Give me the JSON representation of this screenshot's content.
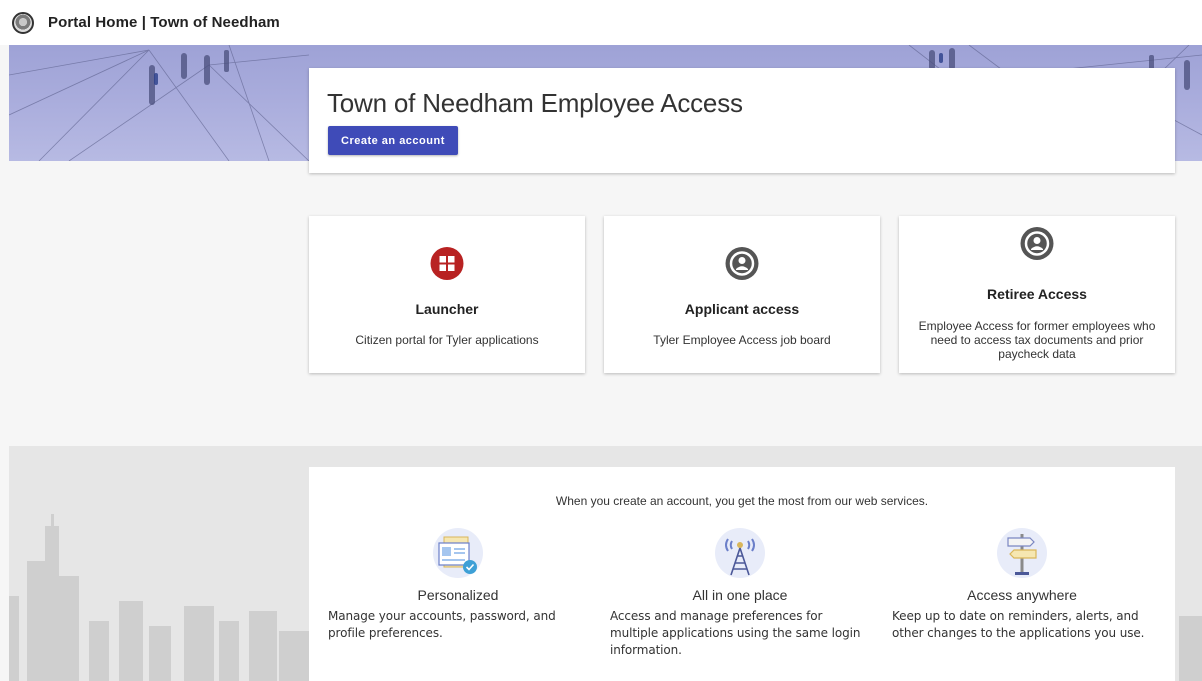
{
  "header": {
    "portal_title": "Portal Home | Town of Needham"
  },
  "hero": {
    "title": "Town of Needham Employee Access",
    "create_account_label": "Create an account"
  },
  "apps": [
    {
      "name": "Launcher",
      "description": "Citizen portal for Tyler applications",
      "icon": "launcher-grid-icon"
    },
    {
      "name": "Applicant access",
      "description": "Tyler Employee Access job board",
      "icon": "user-circle-icon"
    },
    {
      "name": "Retiree Access",
      "description": "Employee Access for former employees who need to access tax documents and prior paycheck data",
      "icon": "user-circle-icon"
    }
  ],
  "benefits": {
    "intro": "When you create an account, you get the most from our web services.",
    "items": [
      {
        "title": "Personalized",
        "description": "Manage your accounts, password, and profile preferences.",
        "icon": "profile-card-icon"
      },
      {
        "title": "All in one place",
        "description": "Access and manage preferences for multiple applications using the same login information.",
        "icon": "antenna-tower-icon"
      },
      {
        "title": "Access anywhere",
        "description": "Keep up to date on reminders, alerts, and other changes to the applications you use.",
        "icon": "signpost-icon"
      }
    ]
  },
  "colors": {
    "primary_button": "#3f4bb8",
    "launcher_icon": "#b82222",
    "user_icon": "#555555",
    "hero_tint": "#a9acdc"
  }
}
